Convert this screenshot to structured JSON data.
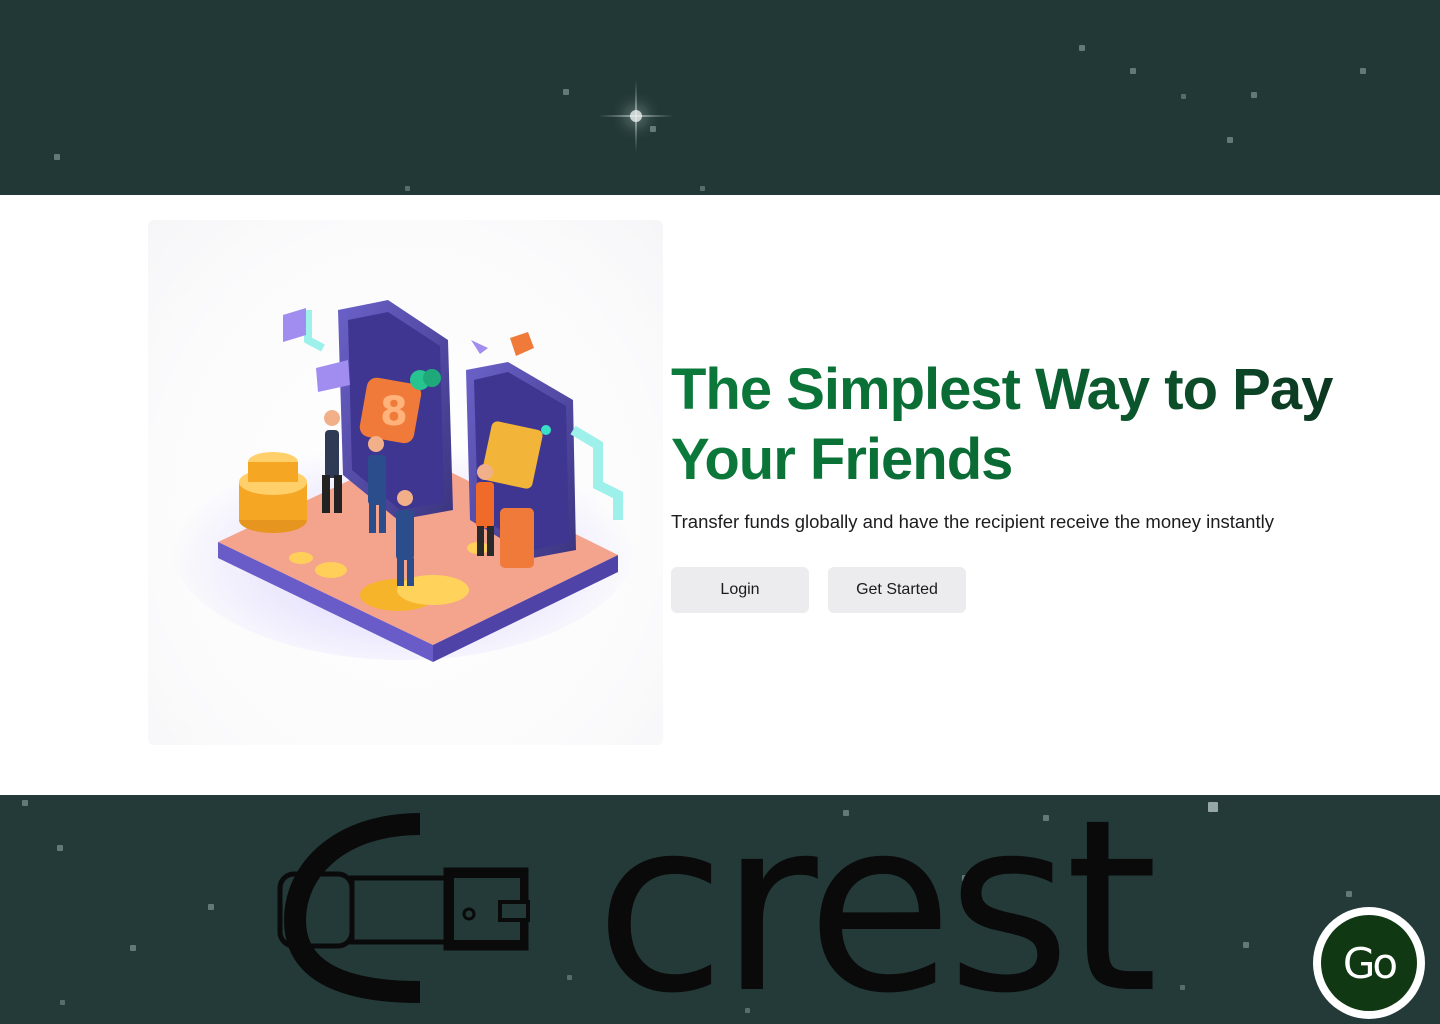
{
  "hero": {
    "headline_line1": "The Simplest Way to Pay",
    "headline_line2": "Your Friends",
    "subtitle": "Transfer funds globally and have the recipient receive the money instantly",
    "login_label": "Login",
    "get_started_label": "Get Started"
  },
  "logo": {
    "text": "crest"
  },
  "badge": {
    "label": "Go"
  },
  "colors": {
    "starfield_bg": "#213836",
    "headline_green": "#0b7a3b",
    "headline_dark": "#0d2e1f",
    "button_bg": "#ececee",
    "badge_green": "#103813"
  },
  "icons": [
    "wallet-icon",
    "payment-illustration"
  ]
}
